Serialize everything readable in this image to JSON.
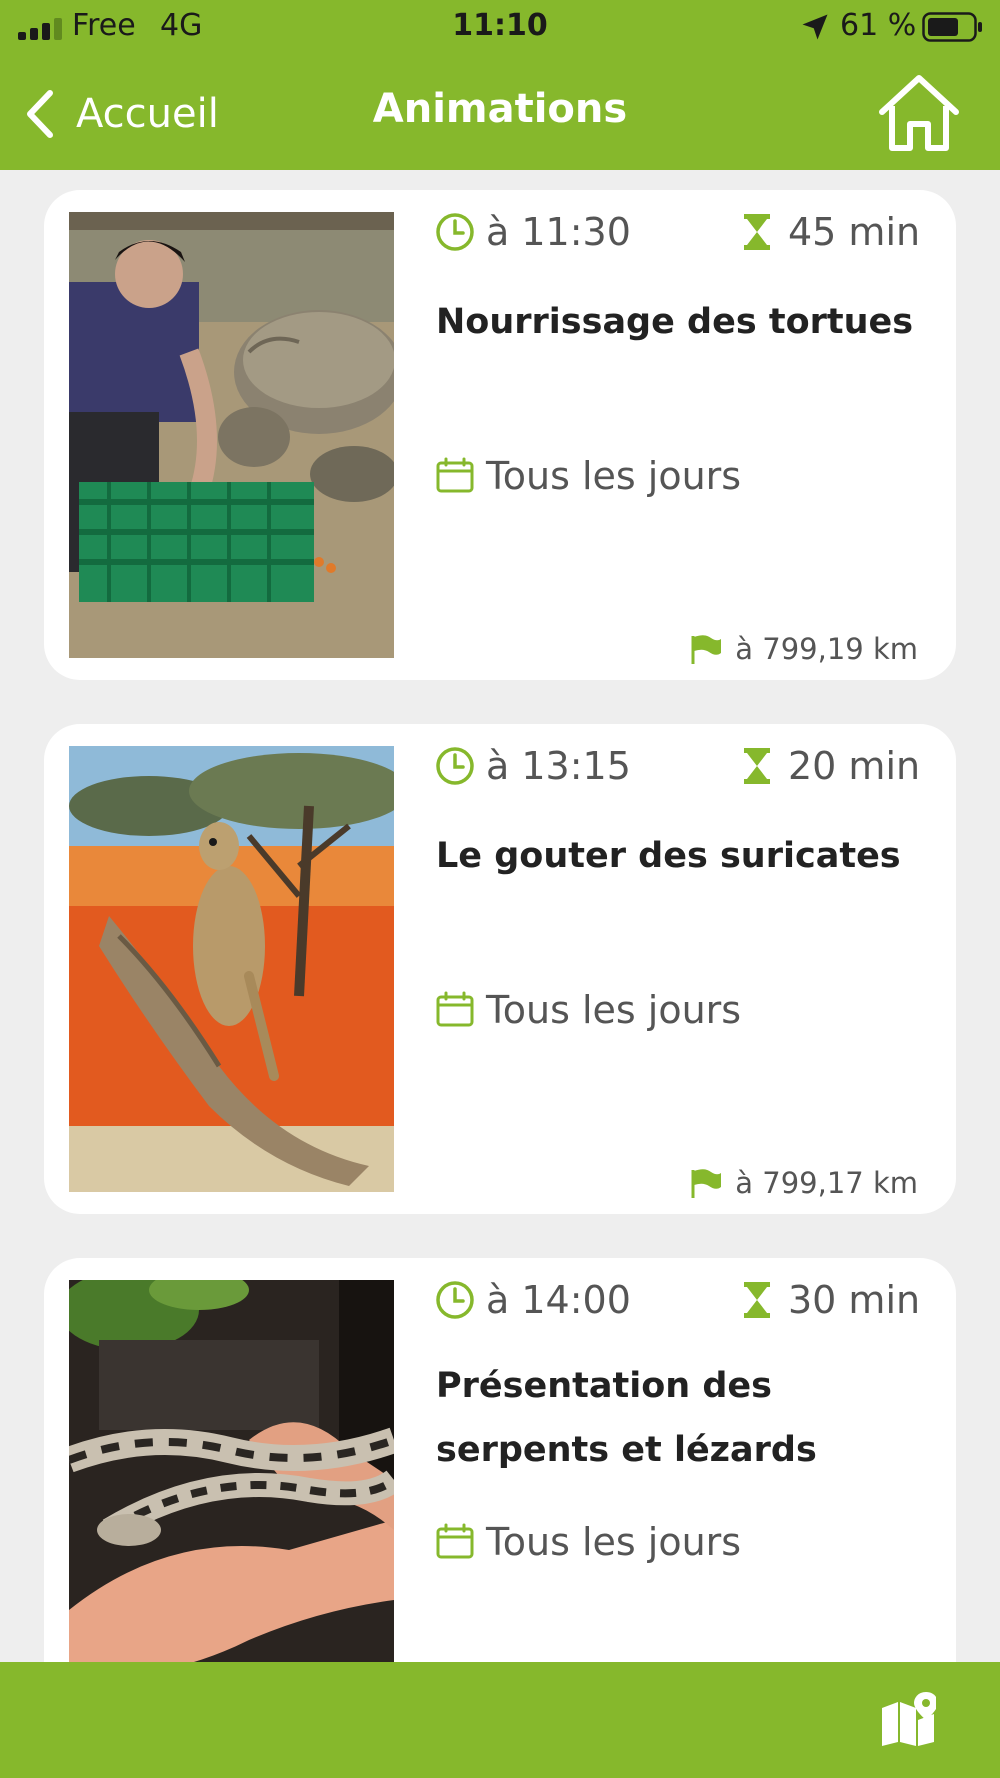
{
  "status": {
    "carrier": "Free",
    "network": "4G",
    "time": "11:10",
    "battery_pct": "61 %"
  },
  "nav": {
    "back_label": "Accueil",
    "title": "Animations"
  },
  "colors": {
    "brand": "#86b82c",
    "card": "#ffffff",
    "background": "#eeeeee",
    "title_text": "#222222",
    "meta_text": "#555555"
  },
  "animations": [
    {
      "time": "à 11:30",
      "duration": "45 min",
      "title": "Nourrissage des tortues",
      "schedule": "Tous les jours",
      "distance": "à 799,19 km",
      "image": "tortoise-feeding-photo"
    },
    {
      "time": "à 13:15",
      "duration": "20 min",
      "title": "Le gouter des suricates",
      "schedule": "Tous les jours",
      "distance": "à 799,17 km",
      "image": "meerkat-photo"
    },
    {
      "time": "à 14:00",
      "duration": "30 min",
      "title": "Présentation des serpents et lézards",
      "schedule": "Tous les jours",
      "image": "snake-photo"
    }
  ],
  "icons": [
    "signal-icon",
    "location-arrow-icon",
    "battery-icon",
    "back-chevron-icon",
    "home-icon",
    "clock-icon",
    "hourglass-icon",
    "calendar-icon",
    "flag-icon",
    "map-pin-icon"
  ]
}
